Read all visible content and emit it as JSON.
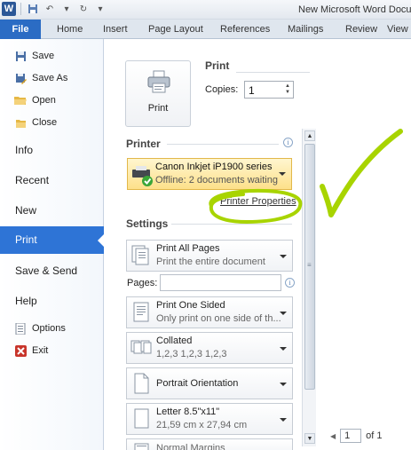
{
  "title_bar": {
    "app_icon": "W",
    "document_title": "New Microsoft Word Docu"
  },
  "ribbon": {
    "file_tab": "File",
    "tabs": [
      "Home",
      "Insert",
      "Page Layout",
      "References",
      "Mailings",
      "Review",
      "View"
    ]
  },
  "nav": {
    "save": "Save",
    "save_as": "Save As",
    "open": "Open",
    "close": "Close",
    "info": "Info",
    "recent": "Recent",
    "new": "New",
    "print": "Print",
    "save_send": "Save & Send",
    "help": "Help",
    "options": "Options",
    "exit": "Exit",
    "selected": "Print"
  },
  "print": {
    "heading": "Print",
    "button_label": "Print",
    "copies_label": "Copies:",
    "copies_value": "1"
  },
  "printer": {
    "heading": "Printer",
    "name": "Canon Inkjet iP1900 series",
    "status": "Offline: 2 documents waiting",
    "properties_link": "Printer Properties"
  },
  "settings": {
    "heading": "Settings",
    "pages_range": {
      "title": "Print All Pages",
      "subtitle": "Print the entire document"
    },
    "pages_label": "Pages:",
    "pages_value": "",
    "sides": {
      "title": "Print One Sided",
      "subtitle": "Only print on one side of th..."
    },
    "collation": {
      "title": "Collated",
      "subtitle": "1,2,3    1,2,3    1,2,3"
    },
    "orientation": {
      "title": "Portrait Orientation"
    },
    "paper": {
      "title": "Letter 8.5\"x11\"",
      "subtitle": "21,59 cm x 27,94 cm"
    },
    "margins": {
      "title": "Normal Margins"
    }
  },
  "pager": {
    "current_page": "1",
    "of_label": "of 1"
  },
  "colors": {
    "file_tab": "#2b6cc4",
    "nav_selected": "#2e74d6",
    "printer_highlight": "#fde08a",
    "annotation": "#a8d400"
  }
}
